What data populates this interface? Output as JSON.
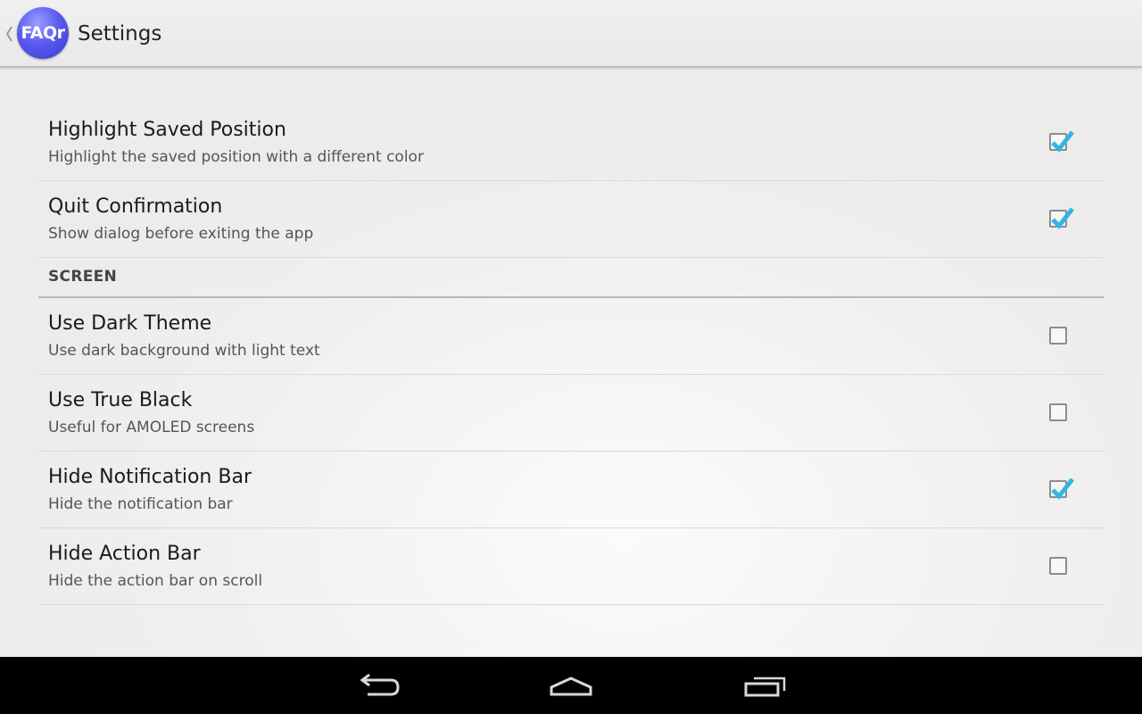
{
  "action_bar": {
    "app_icon_text": "FAQr",
    "title": "Settings"
  },
  "preferences": [
    {
      "type": "item",
      "title": "Highlight Saved Position",
      "summary": "Highlight the saved position with a different color",
      "checked": true
    },
    {
      "type": "item",
      "title": "Quit Confirmation",
      "summary": "Show dialog before exiting the app",
      "checked": true
    },
    {
      "type": "category",
      "title": "SCREEN"
    },
    {
      "type": "item",
      "title": "Use Dark Theme",
      "summary": "Use dark background with light text",
      "checked": false
    },
    {
      "type": "item",
      "title": "Use True Black",
      "summary": "Useful for AMOLED screens",
      "checked": false
    },
    {
      "type": "item",
      "title": "Hide Notification Bar",
      "summary": "Hide the notification bar",
      "checked": true
    },
    {
      "type": "item",
      "title": "Hide Action Bar",
      "summary": "Hide the action bar on scroll",
      "checked": false
    }
  ],
  "nav_bar": {
    "buttons": [
      "back-icon",
      "home-icon",
      "recent-apps-icon"
    ]
  },
  "colors": {
    "check_accent": "#33b5e5",
    "app_icon": "#5a5af0",
    "nav_bar": "#000000"
  }
}
